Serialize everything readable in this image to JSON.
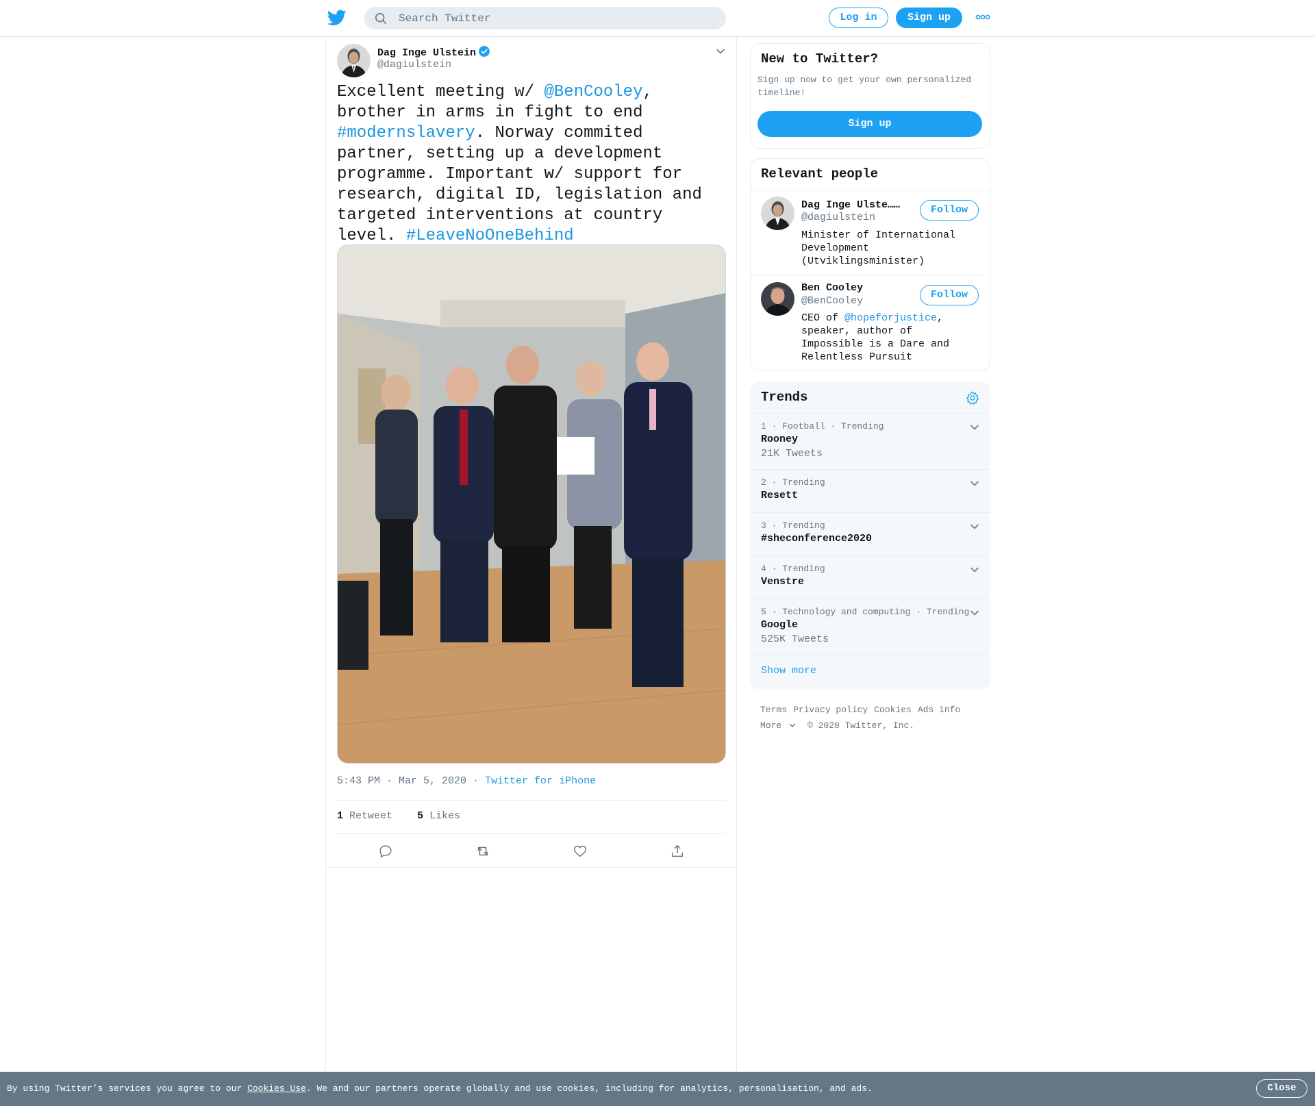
{
  "header": {
    "search_placeholder": "Search Twitter",
    "login_label": "Log in",
    "signup_label": "Sign up"
  },
  "tweet": {
    "author_name": "Dag Inge Ulstein",
    "author_handle": "@dagiulstein",
    "text_parts": {
      "p1": "Excellent meeting w/ ",
      "mention": "@BenCooley",
      "p2": ", brother in arms in fight to end ",
      "hashtag1": "#modernslavery",
      "p3": ". Norway commited partner, setting up a development programme. Important w/ support for research, digital ID, legislation and targeted interventions at country level. ",
      "hashtag2": "#LeaveNoOneBehind"
    },
    "timestamp": "5:43 PM · Mar 5, 2020",
    "source_sep": " · ",
    "source": "Twitter for iPhone",
    "retweet_count": "1",
    "retweet_label": "Retweet",
    "like_count": "5",
    "like_label": "Likes"
  },
  "sidebar": {
    "new_to_twitter": {
      "title": "New to Twitter?",
      "description": "Sign up now to get your own personalized timeline!",
      "signup_label": "Sign up"
    },
    "relevant_people": {
      "title": "Relevant people",
      "people": [
        {
          "name": "Dag Inge Ulste…",
          "handle": "@dagiulstein",
          "follow_label": "Follow",
          "bio": "Minister of International Development (Utviklingsminister)"
        },
        {
          "name": "Ben Cooley",
          "handle": "@BenCooley",
          "follow_label": "Follow",
          "bio_pre": "CEO of ",
          "bio_mention": "@hopeforjustice",
          "bio_post": ", speaker, author of Impossible is a Dare and Relentless Pursuit"
        }
      ]
    },
    "trends": {
      "title": "Trends",
      "items": [
        {
          "meta": "1 · Football · Trending",
          "name": "Rooney",
          "count": "21K Tweets"
        },
        {
          "meta": "2 · Trending",
          "name": "Resett",
          "count": ""
        },
        {
          "meta": "3 · Trending",
          "name": "#sheconference2020",
          "count": ""
        },
        {
          "meta": "4 · Trending",
          "name": "Venstre",
          "count": ""
        },
        {
          "meta": "5 · Technology and computing · Trending",
          "name": "Google",
          "count": "525K Tweets"
        }
      ],
      "show_more": "Show more"
    },
    "footer": {
      "links": [
        "Terms",
        "Privacy policy",
        "Cookies",
        "Ads info"
      ],
      "more_label": "More",
      "copyright": "© 2020 Twitter, Inc."
    }
  },
  "cookie_bar": {
    "text_pre": "By using Twitter’s services you agree to our ",
    "link": "Cookies Use",
    "text_post": ". We and our partners operate globally and use cookies, including for analytics, personalisation, and ads.",
    "close_label": "Close"
  },
  "colors": {
    "accent": "#1da1f2",
    "link": "#1b95e0",
    "muted": "#657786",
    "cookie_bar_bg": "#657786"
  }
}
